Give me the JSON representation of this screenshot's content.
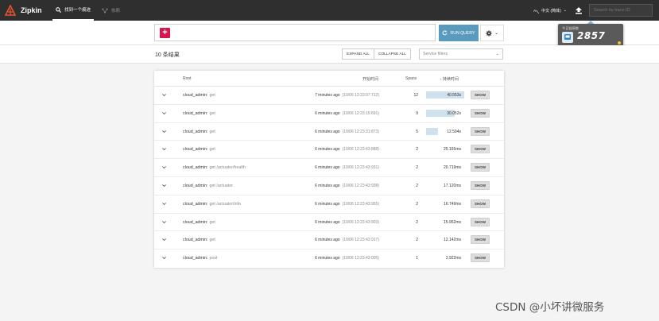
{
  "navbar": {
    "brand": "Zipkin",
    "tabs": [
      {
        "label": "找到一个痕迹"
      },
      {
        "label": "依赖"
      }
    ],
    "language": "中文 (简体)",
    "trace_search_placeholder": "Search by trace ID"
  },
  "search": {
    "run_label": "RUN QUERY"
  },
  "widget": {
    "label": "今日链接数",
    "value": "2857"
  },
  "results": {
    "count_label": "10 条结果",
    "expand_all": "EXPAND ALL",
    "collapse_all": "COLLAPSE ALL",
    "service_filter_placeholder": "Service filters"
  },
  "table": {
    "columns": {
      "root": "Root",
      "start": "开始时间",
      "spans": "Spans",
      "duration": "↓ 持续时间"
    },
    "show_label": "SHOW",
    "rows": [
      {
        "service": "cloud_admin:",
        "op": "get",
        "ago": "7 minutes ago",
        "ts": "(10/06 12:23:07:712)",
        "spans": "12",
        "duration": "40.553s",
        "fill": 1.0
      },
      {
        "service": "cloud_admin:",
        "op": "get",
        "ago": "6 minutes ago",
        "ts": "(10/06 12:23:15:691)",
        "spans": "9",
        "duration": "30.052s",
        "fill": 0.74
      },
      {
        "service": "cloud_admin:",
        "op": "get",
        "ago": "6 minutes ago",
        "ts": "(10/06 12:23:31:873)",
        "spans": "5",
        "duration": "12.594s",
        "fill": 0.31
      },
      {
        "service": "cloud_admin:",
        "op": "get",
        "ago": "6 minutes ago",
        "ts": "(10/06 12:23:43:888)",
        "spans": "2",
        "duration": "25.155ms",
        "fill": 0
      },
      {
        "service": "cloud_admin:",
        "op": "get /actuator/health",
        "ago": "6 minutes ago",
        "ts": "(10/06 12:23:43:931)",
        "spans": "2",
        "duration": "20.719ms",
        "fill": 0
      },
      {
        "service": "cloud_admin:",
        "op": "get /actuator",
        "ago": "6 minutes ago",
        "ts": "(10/06 12:23:43:938)",
        "spans": "2",
        "duration": "17.120ms",
        "fill": 0
      },
      {
        "service": "cloud_admin:",
        "op": "get /actuator/info",
        "ago": "6 minutes ago",
        "ts": "(10/06 12:23:43:955)",
        "spans": "2",
        "duration": "16.749ms",
        "fill": 0
      },
      {
        "service": "cloud_admin:",
        "op": "get",
        "ago": "6 minutes ago",
        "ts": "(10/06 12:23:43:903)",
        "spans": "2",
        "duration": "15.952ms",
        "fill": 0
      },
      {
        "service": "cloud_admin:",
        "op": "get",
        "ago": "6 minutes ago",
        "ts": "(10/06 12:23:43:917)",
        "spans": "2",
        "duration": "12.142ms",
        "fill": 0
      },
      {
        "service": "cloud_admin:",
        "op": "post",
        "ago": "6 minutes ago",
        "ts": "(10/06 12:23:43:005)",
        "spans": "1",
        "duration": "2.922ms",
        "fill": 0
      }
    ]
  },
  "watermark": "CSDN @小坏讲微服务",
  "colors": {
    "navbar": "#2f2f2f",
    "add_button": "#d6174f",
    "run_button": "#5a9bbd",
    "duration_bar": "#cfe1ec"
  }
}
